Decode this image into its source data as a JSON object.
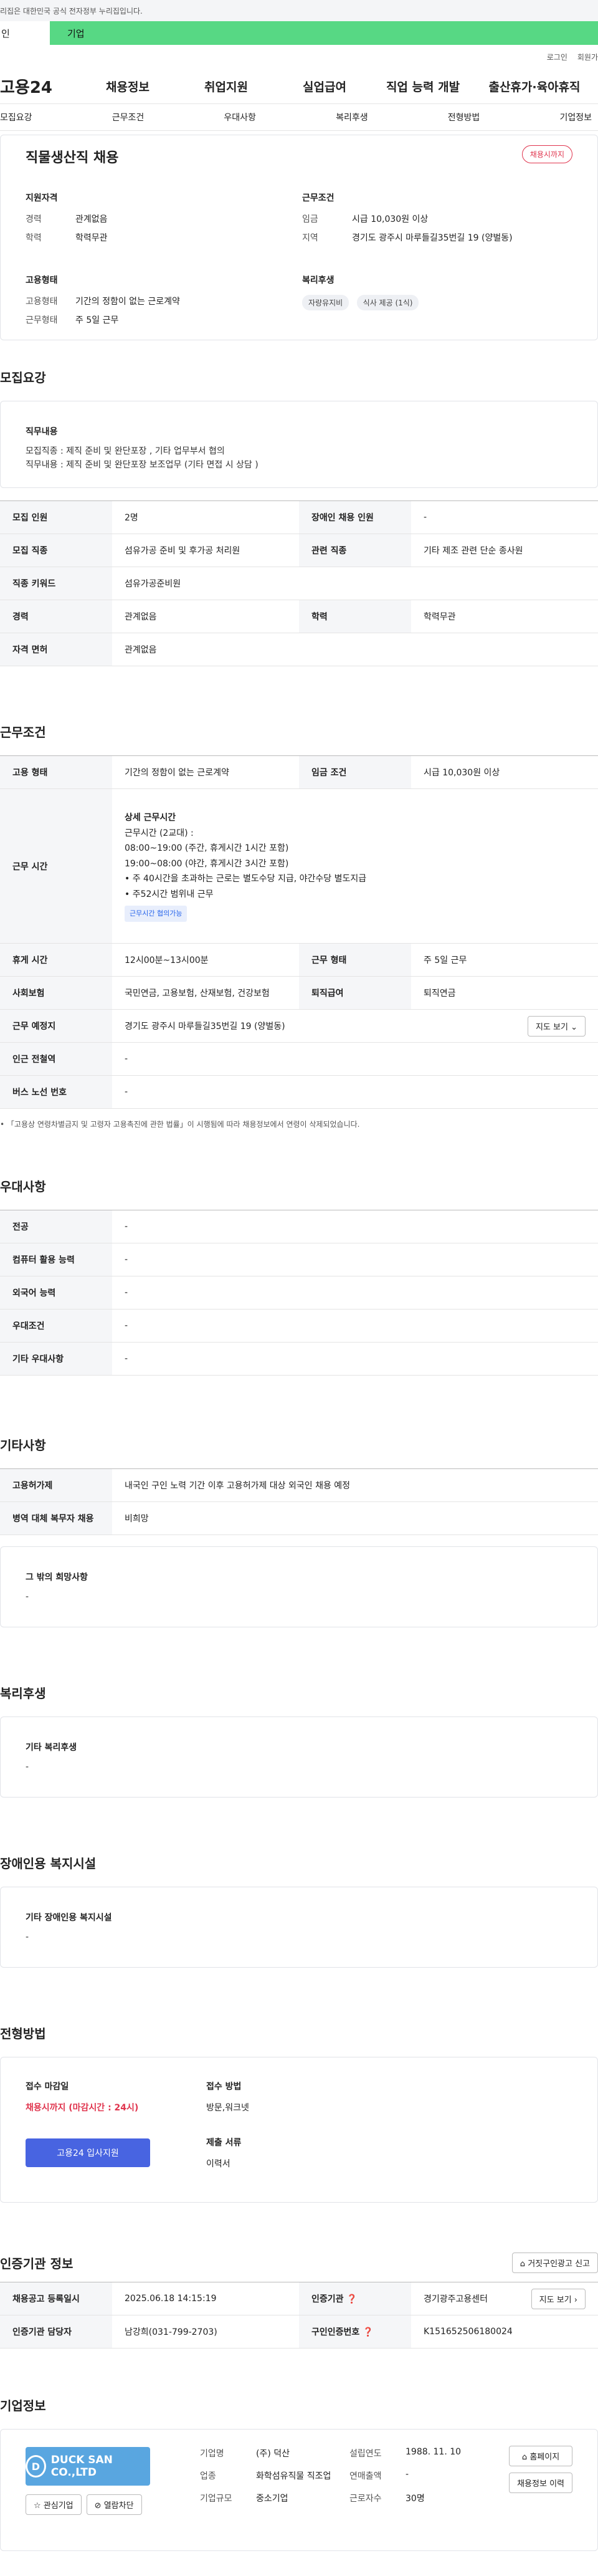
{
  "gov_bar": {
    "text": "리집은 대한민국 공식 전자정부 누리집입니다."
  },
  "top_tabs": {
    "t1": "인",
    "t2": "기업"
  },
  "util": {
    "login": "로그인",
    "join": "회원가"
  },
  "gnb": {
    "logo": "고용24",
    "items": [
      "채용정보",
      "취업지원",
      "실업급여",
      "직업 능력 개발",
      "출산휴가·육아휴직"
    ]
  },
  "subnav": [
    "모집요강",
    "근무조건",
    "우대사항",
    "복리후생",
    "전형방법",
    "기업정보"
  ],
  "job": {
    "title": "직물생산직 채용",
    "deadline_badge": "채용시까지",
    "qual_title": "지원자격",
    "qual": [
      {
        "k": "경력",
        "v": "관계없음"
      },
      {
        "k": "학력",
        "v": "학력무관"
      }
    ],
    "emp_title": "고용형태",
    "emp": [
      {
        "k": "고용형태",
        "v": "기간의 정함이 없는 근로계약"
      },
      {
        "k": "근무형태",
        "v": "주 5일 근무"
      }
    ],
    "cond_title": "근무조건",
    "cond": [
      {
        "k": "임금",
        "v": "시급 10,030원 이상"
      },
      {
        "k": "지역",
        "v": "경기도 광주시 마루들길35번길 19 (양벌동)"
      }
    ],
    "welfare_title": "복리후생",
    "welfare_chips": [
      "자량유지비",
      "식사 제공 (1식)"
    ]
  },
  "recruit": {
    "title": "모집요강",
    "duty_title": "직무내용",
    "duty_lines": [
      "모집직종 : 제직 준비 및 완단포장 , 기타 업무부서 협의",
      "직무내용 : 제직 준비 및 완단포장 보조업무 (기타 면접 시 상담 )"
    ],
    "rows": [
      {
        "k1": "모집 인원",
        "v1": "2명",
        "k2": "장애인 채용 인원",
        "v2": "-"
      },
      {
        "k1": "모집 직종",
        "v1": "섬유가공 준비 및 후가공 처리원",
        "k2": "관련 직종",
        "v2": "기타 제조 관련 단순 종사원"
      },
      {
        "k1": "직종 키워드",
        "v1": "섬유가공준비원"
      },
      {
        "k1": "경력",
        "v1": "관계없음",
        "k2": "학력",
        "v2": "학력무관"
      },
      {
        "k1": "자격 면허",
        "v1": "관계없음"
      }
    ]
  },
  "work": {
    "title": "근무조건",
    "emp_type_k": "고용 형태",
    "emp_type_v": "기간의 정함이 없는 근로계약",
    "wage_k": "임금 조건",
    "wage_v": "시급 10,030원 이상",
    "hours_k": "근무 시간",
    "hours_head": "상세 근무시간",
    "hours_lines": [
      "근무시간 (2교대) :",
      "08:00~19:00 (주간, 휴게시간 1시간 포함)",
      "19:00~08:00 (야간, 휴게시간 3시간 포함)",
      "• 주 40시간을 초과하는 근로는 별도수당 지급, 야간수당 별도지급",
      "• 주52시간 범위내 근무"
    ],
    "hours_badge": "근무시간 협의가능",
    "rest_k": "휴게 시간",
    "rest_v": "12시00분~13시00분",
    "form_k": "근무 형태",
    "form_v": "주 5일 근무",
    "ins_k": "사회보험",
    "ins_v": "국민연금, 고용보험, 산재보험, 건강보험",
    "ret_k": "퇴직급여",
    "ret_v": "퇴직연금",
    "loc_k": "근무 예정지",
    "loc_v": "경기도 광주시 마루들길35번길 19 (양벌동)",
    "map_btn": "지도 보기",
    "sub_k": "인근 전철역",
    "sub_v": "-",
    "bus_k": "버스 노선 번호",
    "bus_v": "-",
    "note": "「고용상 연령차별금지 및 고령자 고용촉진에 관한 법률」이 시행됨에 따라 채용정보에서 연령이 삭제되었습니다."
  },
  "pref": {
    "title": "우대사항",
    "rows": [
      {
        "k": "전공",
        "v": "-"
      },
      {
        "k": "컴퓨터 활용 능력",
        "v": "-"
      },
      {
        "k": "외국어 능력",
        "v": "-"
      },
      {
        "k": "우대조건",
        "v": "-"
      },
      {
        "k": "기타 우대사항",
        "v": "-"
      }
    ]
  },
  "etc": {
    "title": "기타사항",
    "rows": [
      {
        "k": "고용허가제",
        "v": "내국인 구인 노력 기간 이후 고용허가제 대상 외국인 채용 예정"
      },
      {
        "k": "병역 대체 복무자 채용",
        "v": "비희망"
      }
    ],
    "other_title": "그 밖의 희망사항",
    "other_v": "-"
  },
  "welfare": {
    "title": "복리후생",
    "box_title": "기타 복리후생",
    "box_v": "-"
  },
  "disability": {
    "title": "장애인용 복지시설",
    "box_title": "기타 장애인용 복지시설",
    "box_v": "-"
  },
  "process": {
    "title": "전형방법",
    "deadline_title": "접수 마감일",
    "deadline_v": "채용시까지 (마감시간 : 24시)",
    "apply_btn": "고용24 입사지원",
    "method_title": "접수 방법",
    "method_v": "방문,워크넷",
    "docs_title": "제출 서류",
    "docs_v": "이력서"
  },
  "agency": {
    "title": "인증기관 정보",
    "report_btn": "거짓구인광고 신고",
    "rows": [
      {
        "k1": "채용공고 등록일시",
        "v1": "2025.06.18 14:15:19",
        "k2": "인증기관",
        "v2": "경기광주고용센터"
      },
      {
        "k1": "인증기관 담당자",
        "v1": "남강희(031-799-2703)",
        "k2": "구인인증번호",
        "v2": "K151652506180024"
      }
    ],
    "map_btn": "지도 보기"
  },
  "company": {
    "title": "기업정보",
    "logo_text": "DUCK SAN CO.,LTD",
    "logo_mark": "D",
    "fav_btn": "관심기업",
    "block_btn": "열람차단",
    "info": [
      {
        "k": "기업명",
        "v": "(주) 덕산"
      },
      {
        "k": "설립연도",
        "v": "1988. 11. 10"
      },
      {
        "k": "업종",
        "v": "화학섬유직물 직조업"
      },
      {
        "k": "연매출액",
        "v": "-"
      },
      {
        "k": "기업규모",
        "v": "중소기업"
      },
      {
        "k": "근로자수",
        "v": "30명"
      }
    ],
    "home_btn": "홈페이지",
    "history_btn": "채용정보 이력"
  }
}
